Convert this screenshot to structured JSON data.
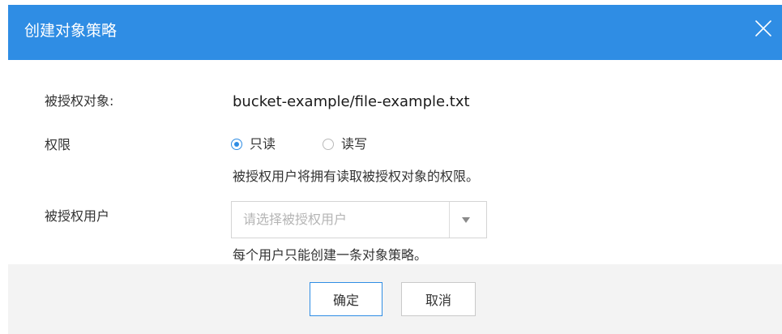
{
  "header": {
    "title": "创建对象策略",
    "background_color": "#2f8de4",
    "close_icon": "close-icon"
  },
  "form": {
    "object_label": "被授权对象:",
    "object_value": "bucket-example/file-example.txt",
    "permission_label": "权限",
    "permission_options": [
      {
        "label": "只读",
        "checked": true
      },
      {
        "label": "读写",
        "checked": false
      }
    ],
    "permission_hint": "被授权用户将拥有读取被授权对象的权限。",
    "user_label": "被授权用户",
    "user_select_placeholder": "请选择被授权用户",
    "user_hint": "每个用户只能创建一条对象策略。"
  },
  "footer": {
    "ok_label": "确定",
    "cancel_label": "取消"
  }
}
